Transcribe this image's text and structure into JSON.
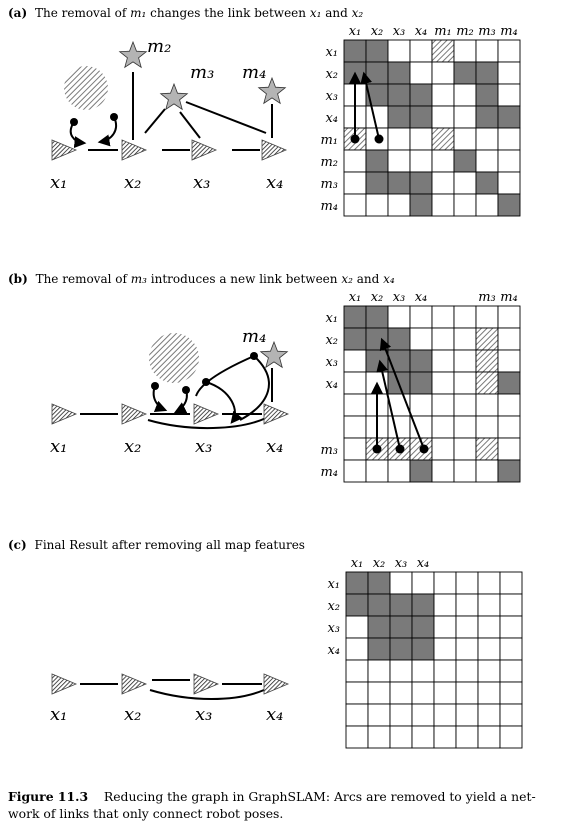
{
  "panels": [
    {
      "label": "(a)",
      "title_pre": "The removal of ",
      "title_sym1": "m₁",
      "title_mid": " changes the link between ",
      "title_sym2": "x₁",
      "title_and": " and ",
      "title_sym3": "x₂",
      "pose_labels": [
        "x₁",
        "x₂",
        "x₃",
        "x₄"
      ],
      "landmark_labels": [
        "m₂",
        "m₃",
        "m₄"
      ],
      "matrix": {
        "col_labels": [
          "x₁",
          "x₂",
          "x₃",
          "x₄",
          "m₁",
          "m₂",
          "m₃",
          "m₄"
        ],
        "row_labels": [
          "x₁",
          "x₂",
          "x₃",
          "x₄",
          "m₁",
          "m₂",
          "m₃",
          "m₄"
        ],
        "filled": [
          [
            0,
            0
          ],
          [
            0,
            1
          ],
          [
            1,
            0
          ],
          [
            1,
            1
          ],
          [
            1,
            2
          ],
          [
            1,
            5
          ],
          [
            1,
            6
          ],
          [
            2,
            1
          ],
          [
            2,
            2
          ],
          [
            2,
            3
          ],
          [
            2,
            6
          ],
          [
            3,
            2
          ],
          [
            3,
            3
          ],
          [
            3,
            6
          ],
          [
            3,
            7
          ],
          [
            5,
            1
          ],
          [
            5,
            5
          ],
          [
            6,
            1
          ],
          [
            6,
            2
          ],
          [
            6,
            3
          ],
          [
            6,
            6
          ],
          [
            7,
            3
          ],
          [
            7,
            7
          ]
        ],
        "hatched": [
          [
            0,
            4
          ],
          [
            4,
            0
          ],
          [
            4,
            4
          ]
        ]
      }
    },
    {
      "label": "(b)",
      "title_pre": "The removal of ",
      "title_sym1": "m₃",
      "title_mid": " introduces a new link between ",
      "title_sym2": "x₂",
      "title_and": " and ",
      "title_sym3": "x₄",
      "pose_labels": [
        "x₁",
        "x₂",
        "x₃",
        "x₄"
      ],
      "landmark_labels": [
        "m₄"
      ],
      "matrix": {
        "col_labels": [
          "x₁",
          "x₂",
          "x₃",
          "x₄",
          "",
          "",
          "m₃",
          "m₄"
        ],
        "row_labels": [
          "x₁",
          "x₂",
          "x₃",
          "x₄",
          "",
          "",
          "m₃",
          "m₄"
        ],
        "filled": [
          [
            0,
            0
          ],
          [
            0,
            1
          ],
          [
            1,
            0
          ],
          [
            1,
            1
          ],
          [
            1,
            2
          ],
          [
            2,
            1
          ],
          [
            2,
            2
          ],
          [
            2,
            3
          ],
          [
            3,
            2
          ],
          [
            3,
            3
          ],
          [
            3,
            7
          ],
          [
            7,
            3
          ],
          [
            7,
            7
          ]
        ],
        "hatched": [
          [
            1,
            6
          ],
          [
            2,
            6
          ],
          [
            3,
            6
          ],
          [
            6,
            1
          ],
          [
            6,
            2
          ],
          [
            6,
            3
          ],
          [
            6,
            6
          ]
        ]
      }
    },
    {
      "label": "(c)",
      "title_pre": "Final Result after removing all map features",
      "pose_labels": [
        "x₁",
        "x₂",
        "x₃",
        "x₄"
      ],
      "matrix": {
        "col_labels": [
          "x₁",
          "x₂",
          "x₃",
          "x₄"
        ],
        "row_labels": [
          "x₁",
          "x₂",
          "x₃",
          "x₄"
        ],
        "filled": [
          [
            0,
            0
          ],
          [
            0,
            1
          ],
          [
            1,
            0
          ],
          [
            1,
            1
          ],
          [
            1,
            2
          ],
          [
            1,
            3
          ],
          [
            2,
            1
          ],
          [
            2,
            2
          ],
          [
            2,
            3
          ],
          [
            3,
            1
          ],
          [
            3,
            2
          ],
          [
            3,
            3
          ]
        ],
        "hatched": []
      }
    }
  ],
  "caption": {
    "figure_number": "Figure 11.3",
    "text": "Reducing the graph in GraphSLAM: Arcs are removed to yield a net- work of links that only connect robot poses."
  },
  "colors": {
    "fill": "#7a7a7a",
    "star": "#b4b4b4",
    "line": "#000000",
    "grid": "#000000"
  }
}
